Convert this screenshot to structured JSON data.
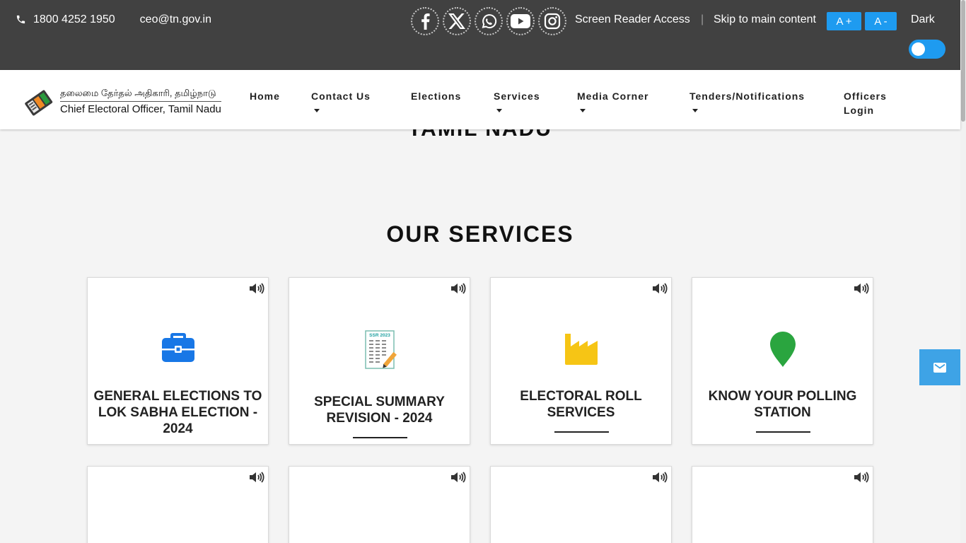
{
  "topbar": {
    "phone": "1800 4252 1950",
    "email": "ceo@tn.gov.in",
    "socials": [
      {
        "name": "facebook-icon"
      },
      {
        "name": "x-twitter-icon"
      },
      {
        "name": "whatsapp-icon"
      },
      {
        "name": "youtube-icon"
      },
      {
        "name": "instagram-icon"
      }
    ],
    "screen_reader": "Screen Reader Access",
    "separator": "|",
    "skip_link": "Skip to main content",
    "font_increase": "A +",
    "font_decrease": "A -",
    "dark_label": "Dark",
    "accent_color": "#1e9bf0",
    "bg_color": "#414141"
  },
  "logo": {
    "tamil": "தலைமை தேர்தல் அதிகாரி, தமிழ்நாடு",
    "english": "Chief Electoral Officer, Tamil Nadu"
  },
  "nav": {
    "home": "Home",
    "contact": "Contact Us",
    "elections": "Elections",
    "services": "Services",
    "media": "Media Corner",
    "tenders": "Tenders/Notifications",
    "officers_line1": "Officers",
    "officers_line2": "Login"
  },
  "hero_tail": "TAMIL NADU",
  "services_title": "OUR SERVICES",
  "cards": [
    {
      "title": "GENERAL ELECTIONS TO LOK SABHA ELECTION - 2024",
      "icon": "briefcase-icon",
      "color": "#1877e6"
    },
    {
      "title": "SPECIAL SUMMARY REVISION - 2024",
      "icon": "ssr-2023-document-icon",
      "badge": "SSR 2023"
    },
    {
      "title": "ELECTORAL ROLL SERVICES",
      "icon": "factory-icon",
      "color": "#f6c515"
    },
    {
      "title": "KNOW YOUR POLLING STATION",
      "icon": "map-pin-icon",
      "color": "#2aa53f"
    }
  ]
}
